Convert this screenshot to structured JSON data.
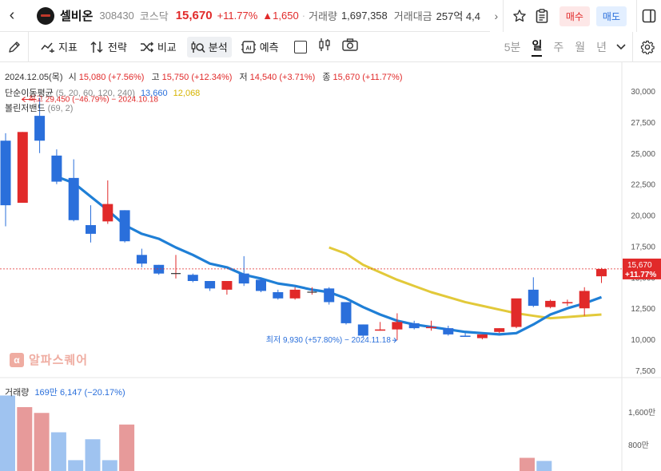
{
  "header": {
    "back_icon": "chevron-left-icon",
    "stock_name": "셀비온",
    "stock_code": "308430",
    "market": "코스닥",
    "price": "15,670",
    "change_pct": "+11.77%",
    "change_abs": "▲1,650",
    "separator": "·",
    "volume_label": "거래량",
    "volume_value": "1,697,358",
    "amount_label": "거래대금",
    "amount_value": "257억 4,4",
    "buy_label": "매수",
    "sell_label": "매도",
    "colors": {
      "up": "#e12a2a",
      "down": "#2a6fdb"
    }
  },
  "toolbar": {
    "indicator_label": "지표",
    "strategy_label": "전략",
    "compare_label": "비교",
    "analysis_label": "분석",
    "predict_label": "예측",
    "ai_label": "AI",
    "periods": [
      "5분",
      "일",
      "주",
      "월",
      "년"
    ],
    "active_period": "일"
  },
  "info": {
    "date": "2024.12.05(목)",
    "open_label": "시",
    "open": "15,080 (+7.56%)",
    "high_label": "고",
    "high": "15,750 (+12.34%)",
    "low_label": "저",
    "low": "14,540 (+3.71%)",
    "close_label": "종",
    "close": "15,670 (+11.77%)",
    "ma_label": "단순이동평균",
    "ma_params": "(5, 20, 60, 120, 240)",
    "ma_val1": "13,660",
    "ma_val2": "12,068",
    "bb_label": "볼린저밴드",
    "bb_params": "(69, 2)",
    "volume_label": "거래량",
    "volume_summary": "169만 6,147 (−20.17%)"
  },
  "watermark": {
    "icon_text": "α",
    "text": "알파스퀘어"
  },
  "chart_data": [
    {
      "type": "candlestick",
      "y_ticks": [
        "30,000",
        "27,500",
        "25,000",
        "22,500",
        "20,000",
        "17,500",
        "15,000",
        "12,500",
        "10,000",
        "7,500"
      ],
      "ylim": [
        7500,
        30000
      ],
      "last_price_label": "15,670",
      "last_pct_label": "+11.77%",
      "high_annotation": "최고 29,450 (−46.79%) − 2024.10.18",
      "low_annotation": "최저 9,930 (+57.80%) − 2024.11.18",
      "candles": [
        {
          "o": 26000,
          "h": 26600,
          "l": 19100,
          "c": 20800
        },
        {
          "o": 21000,
          "h": 26700,
          "l": 21000,
          "c": 26700
        },
        {
          "o": 28000,
          "h": 29450,
          "l": 25000,
          "c": 26000
        },
        {
          "o": 24800,
          "h": 25300,
          "l": 22500,
          "c": 22700
        },
        {
          "o": 23000,
          "h": 24500,
          "l": 19500,
          "c": 19600
        },
        {
          "o": 19200,
          "h": 20800,
          "l": 17800,
          "c": 18500
        },
        {
          "o": 19500,
          "h": 22800,
          "l": 19300,
          "c": 20900
        },
        {
          "o": 20400,
          "h": 20400,
          "l": 17800,
          "c": 17900
        },
        {
          "o": 16800,
          "h": 17300,
          "l": 15800,
          "c": 16100
        },
        {
          "o": 16000,
          "h": 16000,
          "l": 15200,
          "c": 15300
        },
        {
          "o": 15300,
          "h": 16800,
          "l": 14900,
          "c": 15300
        },
        {
          "o": 15200,
          "h": 15300,
          "l": 14600,
          "c": 14700
        },
        {
          "o": 14700,
          "h": 14700,
          "l": 13900,
          "c": 14100
        },
        {
          "o": 14000,
          "h": 14700,
          "l": 13600,
          "c": 14700
        },
        {
          "o": 15300,
          "h": 16700,
          "l": 14300,
          "c": 14500
        },
        {
          "o": 14800,
          "h": 15000,
          "l": 13800,
          "c": 13900
        },
        {
          "o": 13800,
          "h": 14000,
          "l": 13200,
          "c": 13300
        },
        {
          "o": 13300,
          "h": 14200,
          "l": 13200,
          "c": 14000
        },
        {
          "o": 13800,
          "h": 14200,
          "l": 13600,
          "c": 13800
        },
        {
          "o": 14100,
          "h": 14200,
          "l": 12800,
          "c": 13000
        },
        {
          "o": 13000,
          "h": 13000,
          "l": 11200,
          "c": 11300
        },
        {
          "o": 11200,
          "h": 11200,
          "l": 10200,
          "c": 10300
        },
        {
          "o": 10700,
          "h": 11400,
          "l": 10700,
          "c": 10800
        },
        {
          "o": 10800,
          "h": 12100,
          "l": 9930,
          "c": 11400
        },
        {
          "o": 11300,
          "h": 11500,
          "l": 10800,
          "c": 10900
        },
        {
          "o": 10900,
          "h": 11500,
          "l": 10700,
          "c": 11000
        },
        {
          "o": 10900,
          "h": 11100,
          "l": 10300,
          "c": 10400
        },
        {
          "o": 10300,
          "h": 10500,
          "l": 10200,
          "c": 10200
        },
        {
          "o": 10100,
          "h": 10400,
          "l": 10000,
          "c": 10400
        },
        {
          "o": 10600,
          "h": 10900,
          "l": 10500,
          "c": 10900
        },
        {
          "o": 11000,
          "h": 13200,
          "l": 10900,
          "c": 13300
        },
        {
          "o": 14000,
          "h": 15000,
          "l": 12600,
          "c": 12700
        },
        {
          "o": 12600,
          "h": 13200,
          "l": 12500,
          "c": 13100
        },
        {
          "o": 12900,
          "h": 13200,
          "l": 12700,
          "c": 13000
        },
        {
          "o": 12500,
          "h": 14200,
          "l": 11900,
          "c": 13900
        },
        {
          "o": 15080,
          "h": 15750,
          "l": 14540,
          "c": 15670
        }
      ],
      "ma_series": [
        null,
        null,
        null,
        23100,
        22600,
        21500,
        20400,
        19200,
        18500,
        18100,
        17400,
        16800,
        16100,
        15800,
        15200,
        14900,
        14500,
        14300,
        14000,
        13800,
        13300,
        12600,
        12000,
        11500,
        11200,
        11000,
        10800,
        10600,
        10500,
        10400,
        10500,
        11200,
        12000,
        12500,
        12900,
        13400
      ],
      "ma2_series": [
        null,
        null,
        null,
        null,
        null,
        null,
        null,
        null,
        null,
        null,
        null,
        null,
        null,
        null,
        null,
        null,
        null,
        null,
        null,
        17400,
        16900,
        16000,
        15400,
        14800,
        14300,
        13800,
        13400,
        13000,
        12700,
        12400,
        12100,
        11900,
        11700,
        11800,
        11900,
        12000
      ]
    },
    {
      "type": "bar",
      "y_ticks": [
        "1,600만",
        "800만"
      ],
      "values": [
        1950,
        1650,
        1500,
        1000,
        280,
        820,
        280,
        1200,
        0,
        0,
        0,
        0,
        0,
        0,
        0,
        0,
        0,
        0,
        0,
        0,
        0,
        0,
        0,
        0,
        0,
        0,
        0,
        0,
        0,
        0,
        340,
        260
      ],
      "directions": [
        "down",
        "up",
        "up",
        "down",
        "down",
        "down",
        "down",
        "up",
        "n",
        "n",
        "n",
        "n",
        "n",
        "n",
        "n",
        "n",
        "n",
        "n",
        "n",
        "n",
        "n",
        "n",
        "n",
        "n",
        "n",
        "n",
        "n",
        "n",
        "n",
        "n",
        "up",
        "down"
      ]
    }
  ]
}
